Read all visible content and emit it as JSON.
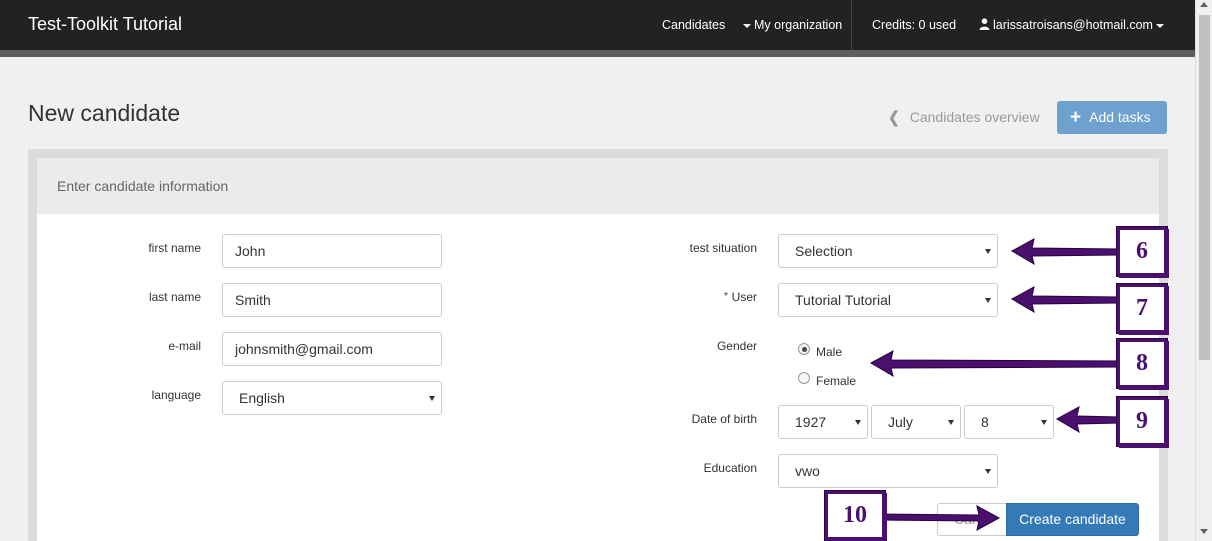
{
  "navbar": {
    "brand": "Test-Toolkit Tutorial",
    "candidates": "Candidates",
    "organization": "My organization",
    "credits": "Credits: 0 used",
    "user_email": "larissatroisans@hotmail.com",
    "background": "#222222"
  },
  "page": {
    "title": "New candidate",
    "overview_link": "Candidates overview",
    "add_tasks": "Add tasks"
  },
  "panel": {
    "heading": "Enter candidate information"
  },
  "form": {
    "first_name": {
      "label": "first name",
      "value": "John"
    },
    "last_name": {
      "label": "last name",
      "value": "Smith"
    },
    "email": {
      "label": "e-mail",
      "value": "johnsmith@gmail.com"
    },
    "language": {
      "label": "language",
      "value": "English"
    },
    "test_situation": {
      "label": "test situation",
      "value": "Selection"
    },
    "user": {
      "required_mark": "*",
      "label": "User",
      "value": "Tutorial Tutorial"
    },
    "gender": {
      "label": "Gender",
      "options": [
        "Male",
        "Female"
      ],
      "selected": "Male"
    },
    "dob": {
      "label": "Date of birth",
      "year": "1927",
      "month": "July",
      "day": "8"
    },
    "education": {
      "label": "Education",
      "value": "vwo"
    },
    "cancel_button": "Canc",
    "create_button": "Create candidate"
  },
  "annotations": {
    "color": "#4b0f6e",
    "markers": [
      "6",
      "7",
      "8",
      "9",
      "10"
    ]
  },
  "colors": {
    "primary": "#337ab7",
    "add_tasks": "#6fa1cf"
  }
}
